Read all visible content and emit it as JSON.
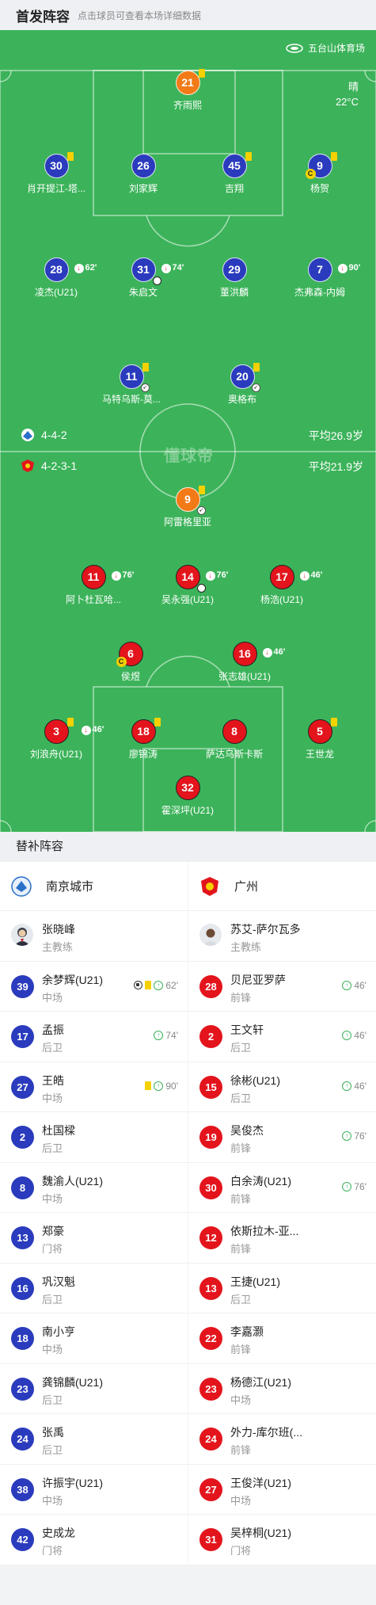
{
  "header": {
    "title": "首发阵容",
    "subtitle": "点击球员可查看本场详细数据"
  },
  "pitch": {
    "venue": "五台山体育场",
    "weather": "晴",
    "temperature": "22°C",
    "watermark": "懂球帝",
    "home_formation": "4-4-2",
    "home_avg_age": "平均26.9岁",
    "away_formation": "4-2-3-1",
    "away_avg_age": "平均21.9岁"
  },
  "home_players": [
    {
      "num": "21",
      "name": "齐雨熙",
      "yellow": true
    },
    {
      "num": "30",
      "name": "肖开提江-塔...",
      "yellow": true
    },
    {
      "num": "26",
      "name": "刘家辉"
    },
    {
      "num": "45",
      "name": "吉翔",
      "yellow": true
    },
    {
      "num": "9",
      "name": "杨贺",
      "yellow": true,
      "captain": "C"
    },
    {
      "num": "28",
      "name": "凌杰(U21)",
      "sub_minute": "62'"
    },
    {
      "num": "31",
      "name": "朱启文",
      "sub_minute": "74'",
      "goal": true
    },
    {
      "num": "29",
      "name": "董洪麟"
    },
    {
      "num": "7",
      "name": "杰弗森-内姆",
      "sub_minute": "90'"
    },
    {
      "num": "11",
      "name": "马特乌斯-莫...",
      "yellow": true,
      "assist": true
    },
    {
      "num": "20",
      "name": "奥格布",
      "yellow": true,
      "assist": true
    }
  ],
  "away_players": [
    {
      "num": "9",
      "name": "阿雷格里亚",
      "yellow": true,
      "assist": true
    },
    {
      "num": "11",
      "name": "阿卜杜瓦哈...",
      "sub_minute": "76'"
    },
    {
      "num": "14",
      "name": "吴永强(U21)",
      "sub_minute": "76'",
      "goal": true
    },
    {
      "num": "17",
      "name": "杨浩(U21)",
      "sub_minute": "46'"
    },
    {
      "num": "6",
      "name": "侯煜",
      "captain": "C"
    },
    {
      "num": "16",
      "name": "张志雄(U21)",
      "sub_minute": "46'"
    },
    {
      "num": "3",
      "name": "刘浪舟(U21)",
      "yellow": true,
      "sub_minute": "46'"
    },
    {
      "num": "18",
      "name": "廖锦涛",
      "yellow": true
    },
    {
      "num": "8",
      "name": "萨达乌斯卡斯"
    },
    {
      "num": "5",
      "name": "王世龙",
      "yellow": true
    },
    {
      "num": "32",
      "name": "霍深坪(U21)"
    }
  ],
  "bench": {
    "title": "替补阵容",
    "home_team": "南京城市",
    "away_team": "广州",
    "home_coach": {
      "name": "张晓峰",
      "role": "主教练"
    },
    "away_coach": {
      "name": "苏艾-萨尔瓦多",
      "role": "主教练"
    },
    "home_subs": [
      {
        "num": "39",
        "name": "余梦辉(U21)",
        "pos": "中场",
        "minute": "62'",
        "goal": true,
        "yellow": true
      },
      {
        "num": "17",
        "name": "孟振",
        "pos": "后卫",
        "minute": "74'"
      },
      {
        "num": "27",
        "name": "王皓",
        "pos": "中场",
        "minute": "90'",
        "yellow": true
      },
      {
        "num": "2",
        "name": "杜国樑",
        "pos": "后卫"
      },
      {
        "num": "8",
        "name": "魏渝人(U21)",
        "pos": "中场"
      },
      {
        "num": "13",
        "name": "郑豪",
        "pos": "门将"
      },
      {
        "num": "16",
        "name": "巩汉魁",
        "pos": "后卫"
      },
      {
        "num": "18",
        "name": "南小亨",
        "pos": "中场"
      },
      {
        "num": "23",
        "name": "龚锦麟(U21)",
        "pos": "后卫"
      },
      {
        "num": "24",
        "name": "张禹",
        "pos": "后卫"
      },
      {
        "num": "38",
        "name": "许振宇(U21)",
        "pos": "中场"
      },
      {
        "num": "42",
        "name": "史成龙",
        "pos": "门将"
      }
    ],
    "away_subs": [
      {
        "num": "28",
        "name": "贝尼亚罗萨",
        "pos": "前锋",
        "minute": "46'"
      },
      {
        "num": "2",
        "name": "王文轩",
        "pos": "后卫",
        "minute": "46'"
      },
      {
        "num": "15",
        "name": "徐彬(U21)",
        "pos": "后卫",
        "minute": "46'"
      },
      {
        "num": "19",
        "name": "吴俊杰",
        "pos": "前锋",
        "minute": "76'"
      },
      {
        "num": "30",
        "name": "白余涛(U21)",
        "pos": "前锋",
        "minute": "76'"
      },
      {
        "num": "12",
        "name": "依斯拉木-亚...",
        "pos": "前锋"
      },
      {
        "num": "13",
        "name": "王捷(U21)",
        "pos": "后卫"
      },
      {
        "num": "22",
        "name": "李嘉灏",
        "pos": "前锋"
      },
      {
        "num": "23",
        "name": "杨德江(U21)",
        "pos": "中场"
      },
      {
        "num": "24",
        "name": "外力-库尔班(...",
        "pos": "前锋"
      },
      {
        "num": "27",
        "name": "王俊洋(U21)",
        "pos": "中场"
      },
      {
        "num": "31",
        "name": "吴梓桐(U21)",
        "pos": "门将"
      }
    ]
  }
}
